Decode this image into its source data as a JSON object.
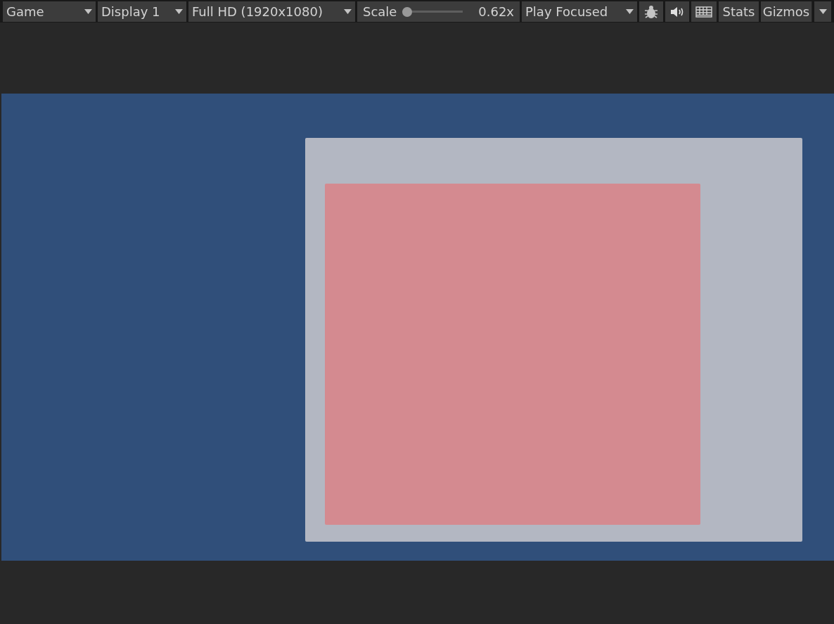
{
  "toolbar": {
    "view_dropdown": {
      "label": "Game"
    },
    "display_dropdown": {
      "label": "Display 1"
    },
    "resolution_dropdown": {
      "label": "Full HD (1920x1080)"
    },
    "scale": {
      "label": "Scale",
      "level": 0,
      "reading": "0.62x"
    },
    "play_mode_dropdown": {
      "label": "Play Focused"
    },
    "stats_button": {
      "label": "Stats"
    },
    "gizmos_button": {
      "label": "Gizmos"
    }
  }
}
